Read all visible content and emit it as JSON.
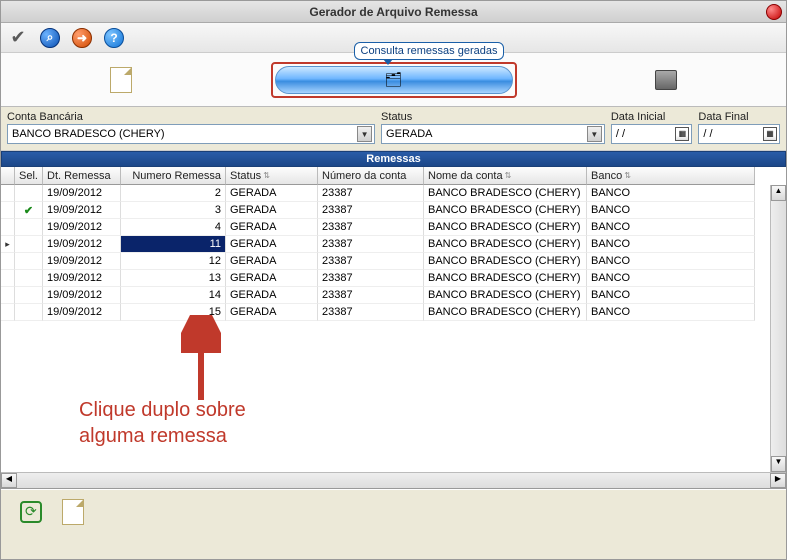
{
  "window": {
    "title": "Gerador de Arquivo Remessa"
  },
  "tooltip": {
    "consulta": "Consulta remessas geradas"
  },
  "filters": {
    "conta_label": "Conta Bancária",
    "conta_value": "BANCO BRADESCO (CHERY)",
    "status_label": "Status",
    "status_value": "GERADA",
    "data_inicial_label": "Data Inicial",
    "data_inicial_value": "  /  /",
    "data_final_label": "Data Final",
    "data_final_value": "  /  /"
  },
  "grid": {
    "title": "Remessas",
    "columns": {
      "sel": "Sel.",
      "dt": "Dt. Remessa",
      "num": "Numero Remessa",
      "status": "Status",
      "numconta": "Número da conta",
      "nome": "Nome da conta",
      "banco": "Banco"
    },
    "rows": [
      {
        "checked": false,
        "current": false,
        "numSelected": false,
        "dt": "19/09/2012",
        "num": "2",
        "status": "GERADA",
        "numconta": "23387",
        "nome": "BANCO BRADESCO (CHERY)",
        "banco": "BANCO"
      },
      {
        "checked": true,
        "current": false,
        "numSelected": false,
        "dt": "19/09/2012",
        "num": "3",
        "status": "GERADA",
        "numconta": "23387",
        "nome": "BANCO BRADESCO (CHERY)",
        "banco": "BANCO"
      },
      {
        "checked": false,
        "current": false,
        "numSelected": false,
        "dt": "19/09/2012",
        "num": "4",
        "status": "GERADA",
        "numconta": "23387",
        "nome": "BANCO BRADESCO (CHERY)",
        "banco": "BANCO"
      },
      {
        "checked": false,
        "current": true,
        "numSelected": true,
        "dt": "19/09/2012",
        "num": "11",
        "status": "GERADA",
        "numconta": "23387",
        "nome": "BANCO BRADESCO (CHERY)",
        "banco": "BANCO"
      },
      {
        "checked": false,
        "current": false,
        "numSelected": false,
        "dt": "19/09/2012",
        "num": "12",
        "status": "GERADA",
        "numconta": "23387",
        "nome": "BANCO BRADESCO (CHERY)",
        "banco": "BANCO"
      },
      {
        "checked": false,
        "current": false,
        "numSelected": false,
        "dt": "19/09/2012",
        "num": "13",
        "status": "GERADA",
        "numconta": "23387",
        "nome": "BANCO BRADESCO (CHERY)",
        "banco": "BANCO"
      },
      {
        "checked": false,
        "current": false,
        "numSelected": false,
        "dt": "19/09/2012",
        "num": "14",
        "status": "GERADA",
        "numconta": "23387",
        "nome": "BANCO BRADESCO (CHERY)",
        "banco": "BANCO"
      },
      {
        "checked": false,
        "current": false,
        "numSelected": false,
        "dt": "19/09/2012",
        "num": "15",
        "status": "GERADA",
        "numconta": "23387",
        "nome": "BANCO BRADESCO (CHERY)",
        "banco": "BANCO"
      }
    ]
  },
  "annotation": {
    "line1": "Clique duplo sobre",
    "line2": "alguma remessa"
  },
  "icons": {
    "check_glyph": "✔",
    "search_glyph": "🔍",
    "arrow_glyph": "➦",
    "help_glyph": "?",
    "folder_glyph": "🗂"
  }
}
